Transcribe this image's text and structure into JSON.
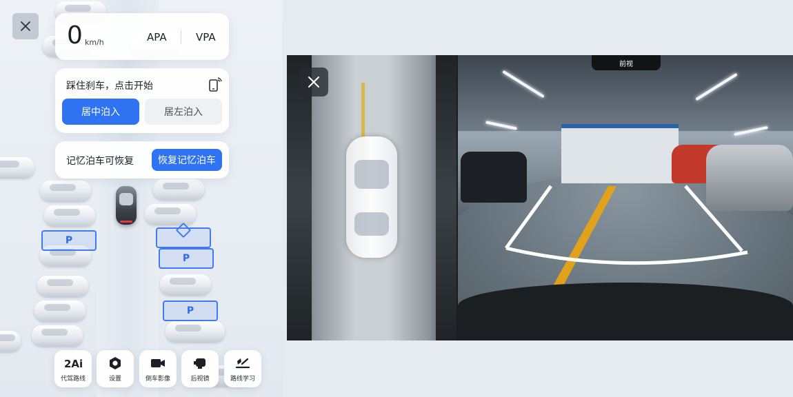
{
  "speed": {
    "value": "0",
    "unit": "km/h"
  },
  "modes": {
    "apa": "APA",
    "vpa": "VPA"
  },
  "action": {
    "hint": "踩住刹车，点击开始",
    "center_label": "居中泊入",
    "left_label": "居左泊入"
  },
  "memory": {
    "text": "记忆泊车可恢复",
    "restore_label": "恢复记忆泊车"
  },
  "toolbar": [
    {
      "label": "代驾路线",
      "icon": "ai-route-icon"
    },
    {
      "label": "设置",
      "icon": "gear-icon"
    },
    {
      "label": "倒车影像",
      "icon": "camera-icon"
    },
    {
      "label": "后视镜",
      "icon": "mirror-icon"
    },
    {
      "label": "路线学习",
      "icon": "route-learn-icon"
    }
  ],
  "bays": {
    "label": "P"
  },
  "camera": {
    "front_label": "前视"
  },
  "colors": {
    "accent": "#2f73f2",
    "bay": "#3f7af0",
    "guide_line": "#ffffff",
    "lane_line": "#d9b32c"
  }
}
